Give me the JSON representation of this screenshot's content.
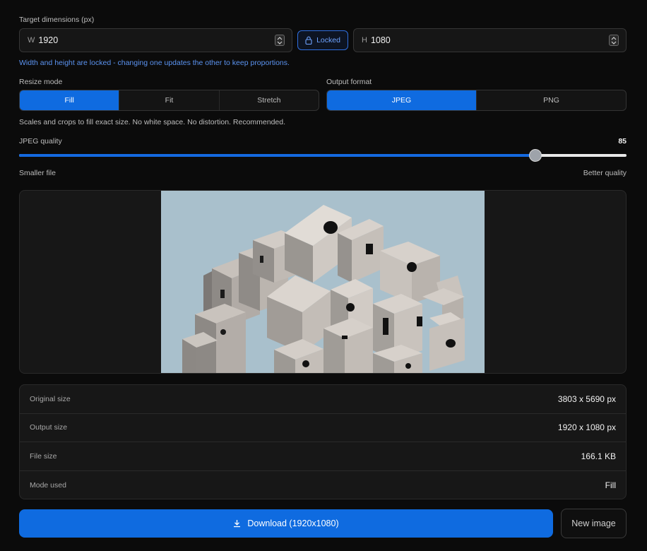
{
  "dimensions": {
    "label": "Target dimensions (px)",
    "width_prefix": "W",
    "width_value": "1920",
    "height_prefix": "H",
    "height_value": "1080",
    "lock_label": "Locked",
    "lock_hint": "Width and height are locked - changing one updates the other to keep proportions."
  },
  "resize_mode": {
    "label": "Resize mode",
    "options": [
      "Fill",
      "Fit",
      "Stretch"
    ],
    "selected": "Fill",
    "description": "Scales and crops to fill exact size. No white space. No distortion. Recommended."
  },
  "output_format": {
    "label": "Output format",
    "options": [
      "JPEG",
      "PNG"
    ],
    "selected": "JPEG"
  },
  "quality": {
    "label": "JPEG quality",
    "value": "85",
    "min_label": "Smaller file",
    "max_label": "Better quality",
    "level_fraction": 0.85
  },
  "preview": {
    "sky_color": "#a9c0cc"
  },
  "info": {
    "rows": [
      {
        "key": "Original size",
        "value": "3803 x 5690 px"
      },
      {
        "key": "Output size",
        "value": "1920 x 1080 px"
      },
      {
        "key": "File size",
        "value": "166.1 KB"
      },
      {
        "key": "Mode used",
        "value": "Fill"
      }
    ]
  },
  "actions": {
    "download_label": "Download (1920x1080)",
    "new_image_label": "New image"
  },
  "colors": {
    "accent": "#0f6be0",
    "background": "#0b0b0b"
  }
}
